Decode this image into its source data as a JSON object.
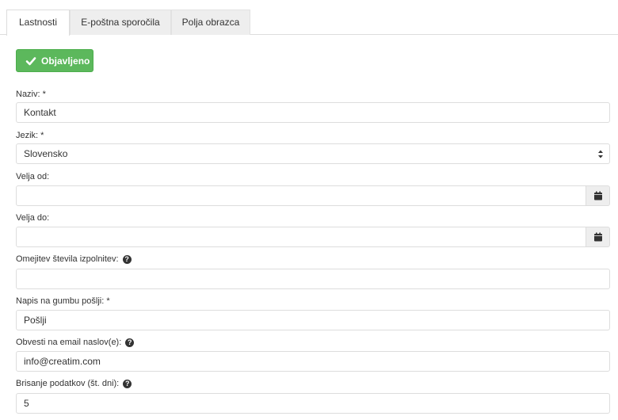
{
  "tabs": [
    {
      "label": "Lastnosti",
      "active": true
    },
    {
      "label": "E-poštna sporočila",
      "active": false
    },
    {
      "label": "Polja obrazca",
      "active": false
    }
  ],
  "publish_button": {
    "label": "Objavljeno",
    "color": "#5cb85c"
  },
  "form": {
    "naziv": {
      "label": "Naziv: *",
      "value": "Kontakt"
    },
    "jezik": {
      "label": "Jezik: *",
      "value": "Slovensko"
    },
    "velja_od": {
      "label": "Velja od:",
      "value": ""
    },
    "velja_do": {
      "label": "Velja do:",
      "value": ""
    },
    "omejitev": {
      "label": "Omejitev števila izpolnitev:",
      "value": ""
    },
    "napis": {
      "label": "Napis na gumbu pošlji: *",
      "value": "Pošlji"
    },
    "obvesti": {
      "label": "Obvesti na email naslov(e):",
      "value": "info@creatim.com"
    },
    "brisanje": {
      "label": "Brisanje podatkov (št. dni):",
      "value": "5"
    }
  },
  "icons": {
    "calendar": "calendar-icon",
    "help": "question-circle-icon",
    "check": "check-icon"
  }
}
